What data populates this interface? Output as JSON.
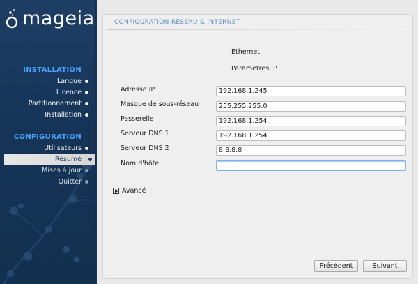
{
  "sidebar": {
    "logo_text": "mageia",
    "sections": [
      {
        "title": "INSTALLATION",
        "items": [
          {
            "label": "Langue"
          },
          {
            "label": "Licence"
          },
          {
            "label": "Partitionnement"
          },
          {
            "label": "Installation"
          }
        ]
      },
      {
        "title": "CONFIGURATION",
        "items": [
          {
            "label": "Utilisateurs"
          },
          {
            "label": "Résumé"
          },
          {
            "label": "Mises à jour"
          },
          {
            "label": "Quitter"
          }
        ]
      }
    ]
  },
  "panel": {
    "title": "CONFIGURATION RÉSEAU & INTERNET",
    "subtitle1": "Ethernet",
    "subtitle2": "Paramètres IP",
    "fields": [
      {
        "label": "Adresse IP",
        "value": "192.168.1.245"
      },
      {
        "label": "Masque de sous-réseau",
        "value": "255.255.255.0"
      },
      {
        "label": "Passerelle",
        "value": "192.168.1.254"
      },
      {
        "label": "Serveur DNS 1",
        "value": "192.168.1.254"
      },
      {
        "label": "Serveur DNS 2",
        "value": "8.8.8.8"
      },
      {
        "label": "Nom d'hôte",
        "value": ""
      }
    ],
    "advanced_label": "Avancé",
    "buttons": {
      "previous": "Précédent",
      "next": "Suivant"
    }
  }
}
